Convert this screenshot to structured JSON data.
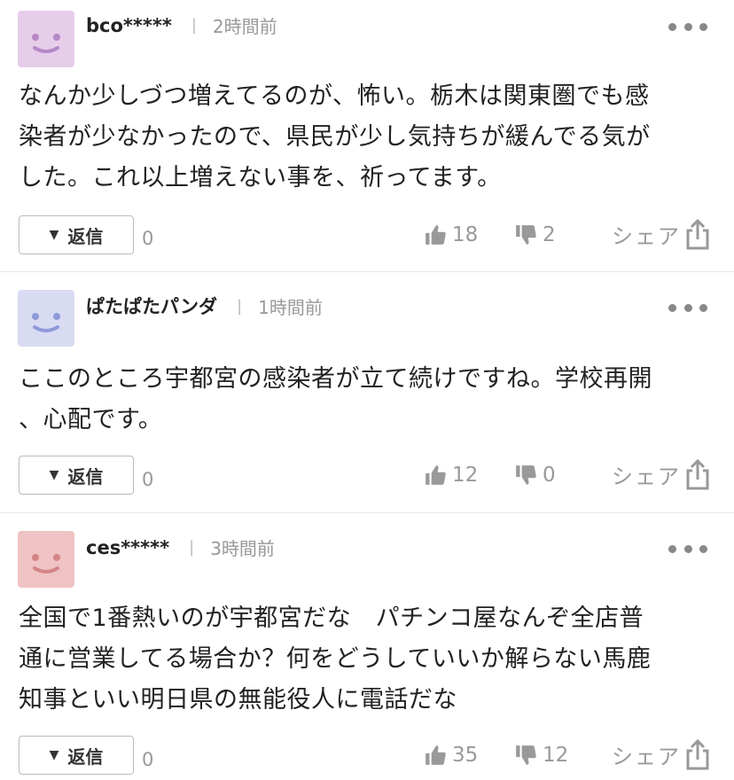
{
  "comments": [
    {
      "username": "bco*****",
      "time": "2時間前",
      "avatar_color": "#e6cdea",
      "face_color": "#b689c6",
      "lines": [
        "なんか少しづつ増えてるのが、怖い。栃木は関東圏でも感",
        "染者が少なかったので、県民が少し気持ちが緩んでる気が",
        "した。これ以上増えない事を、祈ってます。"
      ],
      "reply_label": "返信",
      "reply_count": "0",
      "likes": "18",
      "dislikes": "2",
      "share_label": "シェア"
    },
    {
      "username": "ぱたぱたパンダ",
      "time": "1時間前",
      "avatar_color": "#d9dbf3",
      "face_color": "#8f9ad8",
      "lines": [
        "ここのところ宇都宮の感染者が立て続けですね。学校再開",
        "、心配です。"
      ],
      "reply_label": "返信",
      "reply_count": "0",
      "likes": "12",
      "dislikes": "0",
      "share_label": "シェア"
    },
    {
      "username": "ces*****",
      "time": "3時間前",
      "avatar_color": "#efc3c3",
      "face_color": "#d48585",
      "lines": [
        "全国で1番熱いのが宇都宮だな　パチンコ屋なんぞ全店普",
        "通に営業してる場合か？何をどうしていいか解らない馬鹿",
        "知事といい明日県の無能役人に電話だな"
      ],
      "reply_label": "返信",
      "reply_count": "0",
      "likes": "35",
      "dislikes": "12",
      "share_label": "シェア"
    }
  ]
}
